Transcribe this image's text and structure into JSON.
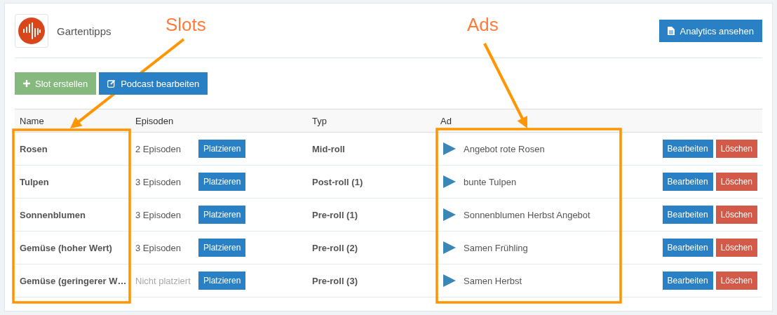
{
  "podcast": {
    "title": "Gartentipps"
  },
  "header_button": {
    "label": "Analytics ansehen"
  },
  "toolbar": [
    {
      "label": "Slot erstellen",
      "kind": "create"
    },
    {
      "label": "Podcast bearbeiten",
      "kind": "edit"
    }
  ],
  "table": {
    "columns": [
      "Name",
      "Episoden",
      "Typ",
      "Ad"
    ],
    "rows": [
      {
        "name": "Rosen",
        "episodes": "2 Episoden",
        "placed": true,
        "place_button": "Platzieren",
        "type": "Mid-roll",
        "ad": "Angebot rote Rosen",
        "edit_button": "Bearbeiten",
        "delete_button": "Löschen"
      },
      {
        "name": "Tulpen",
        "episodes": "3 Episoden",
        "placed": true,
        "place_button": "Platzieren",
        "type": "Post-roll (1)",
        "ad": "bunte Tulpen",
        "edit_button": "Bearbeiten",
        "delete_button": "Löschen"
      },
      {
        "name": "Sonnenblumen",
        "episodes": "3 Episoden",
        "placed": true,
        "place_button": "Platzieren",
        "type": "Pre-roll (1)",
        "ad": "Sonnenblumen Herbst Angebot",
        "edit_button": "Bearbeiten",
        "delete_button": "Löschen"
      },
      {
        "name": "Gemüse (hoher Wert)",
        "episodes": "3 Episoden",
        "placed": true,
        "place_button": "Platzieren",
        "type": "Pre-roll (2)",
        "ad": "Samen Frühling",
        "edit_button": "Bearbeiten",
        "delete_button": "Löschen"
      },
      {
        "name": "Gemüse (geringerer W…",
        "episodes": "Nicht platziert",
        "placed": false,
        "place_button": "Platzieren",
        "type": "Pre-roll (3)",
        "ad": "Samen Herbst",
        "edit_button": "Bearbeiten",
        "delete_button": "Löschen"
      }
    ]
  },
  "annotations": [
    {
      "label": "Slots"
    },
    {
      "label": "Ads"
    }
  ]
}
